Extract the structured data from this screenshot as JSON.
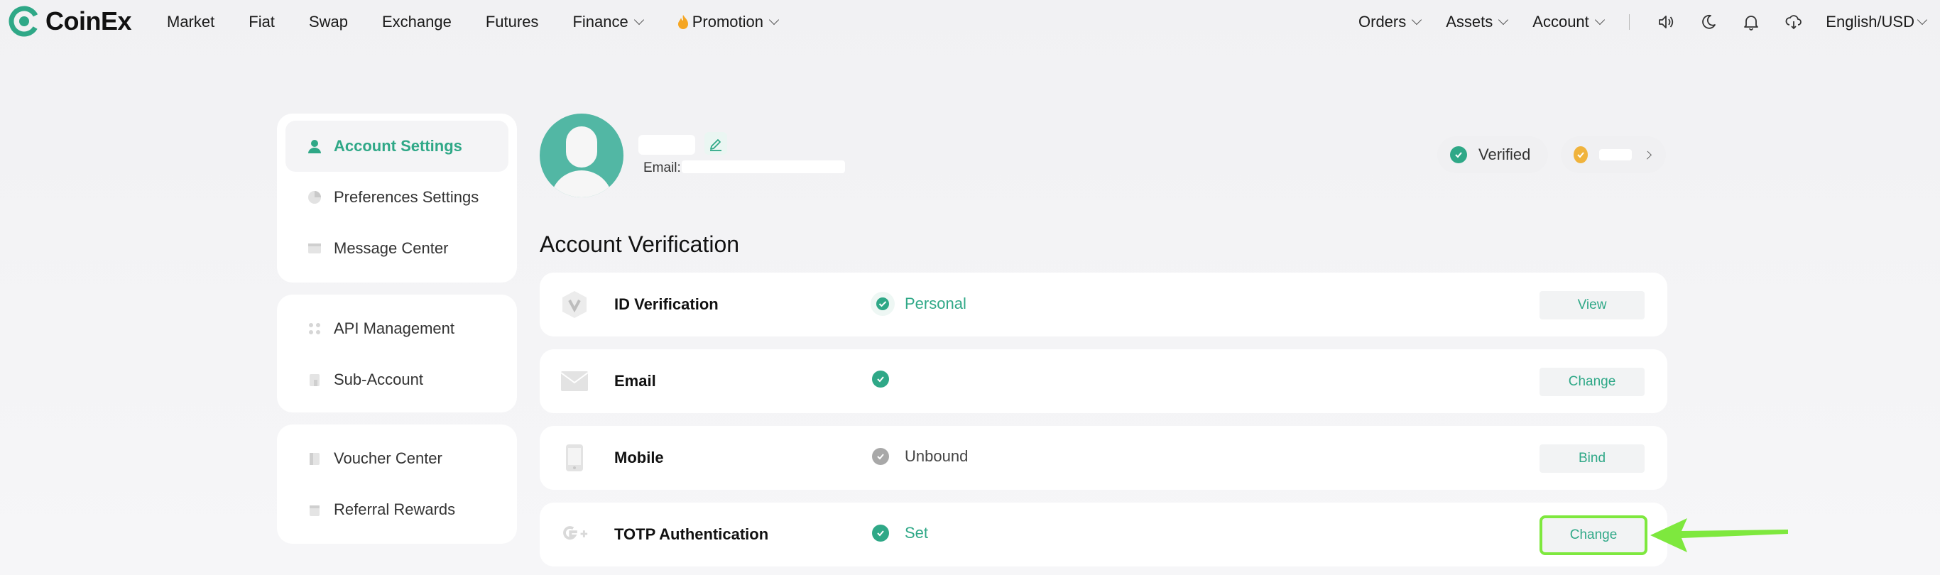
{
  "brand": {
    "name": "CoinEx",
    "accent": "#2fa887",
    "highlight": "#7ee83e"
  },
  "nav": {
    "left": [
      {
        "label": "Market",
        "dropdown": false
      },
      {
        "label": "Fiat",
        "dropdown": false
      },
      {
        "label": "Swap",
        "dropdown": false
      },
      {
        "label": "Exchange",
        "dropdown": false
      },
      {
        "label": "Futures",
        "dropdown": false
      },
      {
        "label": "Finance",
        "dropdown": true
      },
      {
        "label": "Promotion",
        "dropdown": true,
        "icon": "flame-icon"
      }
    ],
    "right": {
      "orders": "Orders",
      "assets": "Assets",
      "account": "Account",
      "language": "English/USD",
      "icons": [
        "speaker-icon",
        "moon-icon",
        "bell-icon",
        "download-cloud-icon"
      ]
    }
  },
  "sidebar": {
    "group1": [
      {
        "label": "Account Settings",
        "icon": "user-icon",
        "active": true
      },
      {
        "label": "Preferences Settings",
        "icon": "preferences-icon",
        "active": false
      },
      {
        "label": "Message Center",
        "icon": "message-icon",
        "active": false
      }
    ],
    "group2": [
      {
        "label": "API Management",
        "icon": "api-icon",
        "active": false
      },
      {
        "label": "Sub-Account",
        "icon": "sub-account-icon",
        "active": false
      }
    ],
    "group3": [
      {
        "label": "Voucher Center",
        "icon": "voucher-icon",
        "active": false
      },
      {
        "label": "Referral Rewards",
        "icon": "referral-icon",
        "active": false
      }
    ]
  },
  "profile": {
    "email_label": "Email:",
    "verified_label": "Verified"
  },
  "verification": {
    "title": "Account Verification",
    "rows": [
      {
        "title": "ID Verification",
        "status": "Personal",
        "status_style": "badge",
        "button": "View",
        "icon": "id-verification-icon"
      },
      {
        "title": "Email",
        "status": "",
        "status_style": "green",
        "button": "Change",
        "icon": "email-icon"
      },
      {
        "title": "Mobile",
        "status": "Unbound",
        "status_style": "grey",
        "button": "Bind",
        "icon": "mobile-icon"
      },
      {
        "title": "TOTP Authentication",
        "status": "Set",
        "status_style": "green",
        "button": "Change",
        "icon": "google-authenticator-icon"
      }
    ]
  }
}
